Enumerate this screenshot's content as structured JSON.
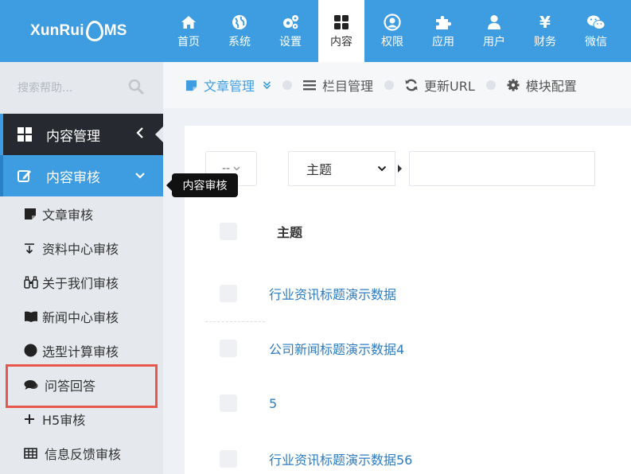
{
  "logo": {
    "text_a": "XunRui",
    "text_b": "MS"
  },
  "nav": [
    {
      "label": "首页",
      "icon": "home-icon"
    },
    {
      "label": "系统",
      "icon": "globe-icon"
    },
    {
      "label": "设置",
      "icon": "gears-icon"
    },
    {
      "label": "内容",
      "icon": "grid-icon",
      "active": true
    },
    {
      "label": "权限",
      "icon": "user-circle-icon"
    },
    {
      "label": "应用",
      "icon": "puzzle-icon"
    },
    {
      "label": "用户",
      "icon": "user-icon"
    },
    {
      "label": "财务",
      "icon": "yen-icon"
    },
    {
      "label": "微信",
      "icon": "wechat-icon"
    }
  ],
  "search": {
    "placeholder": "搜索帮助..."
  },
  "sidebar": {
    "group1": {
      "label": "内容管理"
    },
    "group2": {
      "label": "内容审核"
    },
    "items": [
      {
        "label": "文章审核",
        "icon": "note-icon"
      },
      {
        "label": "资料中心审核",
        "icon": "download-icon"
      },
      {
        "label": "关于我们审核",
        "icon": "binoculars-icon"
      },
      {
        "label": "新闻中心审核",
        "icon": "book-icon"
      },
      {
        "label": "选型计算审核",
        "icon": "circle-icon"
      },
      {
        "label": "问答回答",
        "icon": "comments-icon"
      },
      {
        "label": "H5审核",
        "icon": "plus-icon"
      },
      {
        "label": "信息反馈审核",
        "icon": "table-icon"
      }
    ]
  },
  "tooltip": "内容审核",
  "tabs": [
    {
      "label": "文章管理",
      "icon": "note-icon",
      "active": true
    },
    {
      "label": "栏目管理",
      "icon": "list-icon"
    },
    {
      "label": "更新URL",
      "icon": "refresh-icon"
    },
    {
      "label": "模块配置",
      "icon": "gear-icon"
    }
  ],
  "filter": {
    "select1": "--",
    "select2": "主题"
  },
  "table": {
    "header": "主题",
    "rows": [
      "行业资讯标题演示数据",
      "公司新闻标题演示数据4",
      "5",
      "行业资讯标题演示数据56"
    ]
  },
  "colors": {
    "brand": "#3d9de0",
    "dark": "#262a30",
    "highlight": "#e8574b"
  }
}
